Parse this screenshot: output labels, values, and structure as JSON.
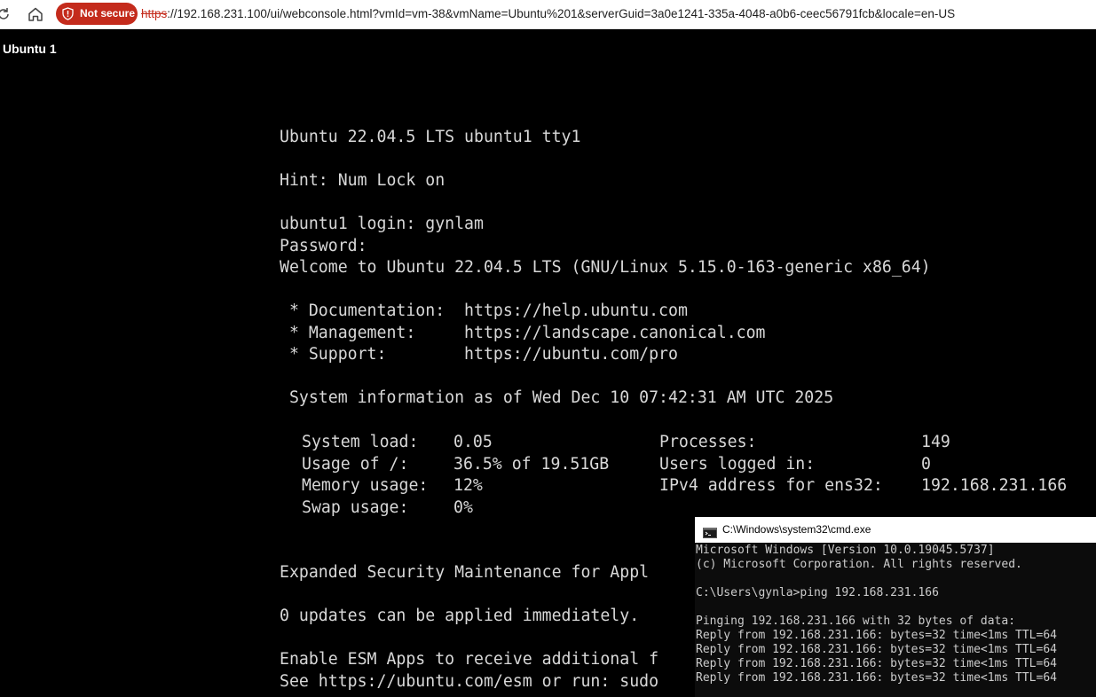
{
  "browser": {
    "security_label": "Not secure",
    "url_scheme": "https",
    "url_rest": "://192.168.231.100/ui/webconsole.html?vmId=vm-38&vmName=Ubuntu%201&serverGuid=3a0e1241-335a-4048-a0b6-ceec56791fcb&locale=en-US",
    "security_color": "#c42b1c"
  },
  "page": {
    "vm_title": "Ubuntu 1"
  },
  "console": {
    "lines": [
      "Ubuntu 22.04.5 LTS ubuntu1 tty1",
      "",
      "Hint: Num Lock on",
      "",
      "ubuntu1 login: gynlam",
      "Password:",
      "Welcome to Ubuntu 22.04.5 LTS (GNU/Linux 5.15.0-163-generic x86_64)",
      "",
      " * Documentation:  https://help.ubuntu.com",
      " * Management:     https://landscape.canonical.com",
      " * Support:        https://ubuntu.com/pro",
      "",
      " System information as of Wed Dec 10 07:42:31 AM UTC 2025"
    ],
    "sysinfo": [
      {
        "label": "System load:",
        "value": "0.05",
        "label2": "Processes:",
        "value2": "149"
      },
      {
        "label": "Usage of /:",
        "value": "36.5% of 19.51GB",
        "label2": "Users logged in:",
        "value2": "0"
      },
      {
        "label": "Memory usage:",
        "value": "12%",
        "label2": "IPv4 address for ens32:",
        "value2": "192.168.231.166"
      },
      {
        "label": "Swap usage:",
        "value": "0%",
        "label2": "",
        "value2": ""
      }
    ],
    "lines_after": [
      "Expanded Security Maintenance for Appl",
      "",
      "0 updates can be applied immediately.",
      "",
      "Enable ESM Apps to receive additional f",
      "See https://ubuntu.com/esm or run: sudo"
    ]
  },
  "cmd": {
    "title": "C:\\Windows\\system32\\cmd.exe",
    "lines": [
      "Microsoft Windows [Version 10.0.19045.5737]",
      "(c) Microsoft Corporation. All rights reserved.",
      "",
      "C:\\Users\\gynla>ping 192.168.231.166",
      "",
      "Pinging 192.168.231.166 with 32 bytes of data:",
      "Reply from 192.168.231.166: bytes=32 time<1ms TTL=64",
      "Reply from 192.168.231.166: bytes=32 time<1ms TTL=64",
      "Reply from 192.168.231.166: bytes=32 time<1ms TTL=64",
      "Reply from 192.168.231.166: bytes=32 time<1ms TTL=64"
    ]
  }
}
